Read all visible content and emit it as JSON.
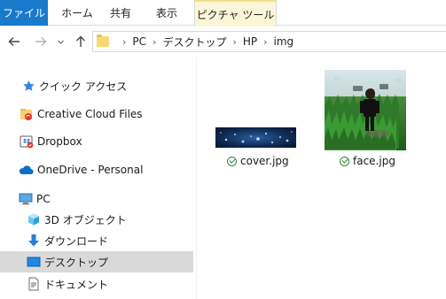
{
  "ribbon": {
    "file_tab": "ファイル",
    "tabs": [
      "ホーム",
      "共有",
      "表示"
    ],
    "context_tab": "ピクチャ ツール"
  },
  "nav": {
    "back_icon": "arrow-left-icon",
    "forward_icon": "arrow-right-icon",
    "recent_icon": "chevron-down-icon",
    "up_icon": "arrow-up-icon"
  },
  "address": {
    "crumbs": [
      "PC",
      "デスクトップ",
      "HP",
      "img"
    ]
  },
  "sidebar": {
    "items": [
      {
        "label": "クイック アクセス",
        "icon": "star-icon"
      },
      {
        "label": "Creative Cloud Files",
        "icon": "creative-cloud-icon"
      },
      {
        "label": "Dropbox",
        "icon": "dropbox-icon"
      },
      {
        "label": "OneDrive - Personal",
        "icon": "cloud-icon"
      },
      {
        "label": "PC",
        "icon": "computer-icon"
      },
      {
        "label": "3D オブジェクト",
        "icon": "cube-icon"
      },
      {
        "label": "ダウンロード",
        "icon": "download-arrow-icon"
      },
      {
        "label": "デスクトップ",
        "icon": "desktop-icon"
      },
      {
        "label": "ドキュメント",
        "icon": "document-icon"
      }
    ],
    "selected_index": 7
  },
  "files": [
    {
      "name": "cover.jpg",
      "status": "synced"
    },
    {
      "name": "face.jpg",
      "status": "synced"
    }
  ],
  "colors": {
    "file_tab": "#1979ca",
    "context_tab": "#fbf6d8",
    "selected": "#d9d9d9",
    "sync_check": "#2f8a3b"
  }
}
